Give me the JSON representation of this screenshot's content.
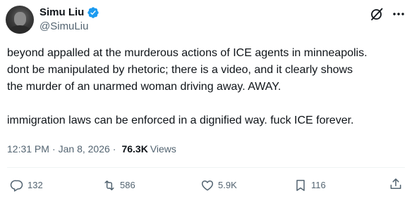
{
  "author": {
    "display_name": "Simu Liu",
    "handle": "@SimuLiu",
    "verified": true
  },
  "tweet": {
    "lines": [
      "beyond appalled at the murderous actions of ICE agents in minneapolis.",
      "dont be manipulated by rhetoric; there is a video, and it clearly shows",
      "the murder of an unarmed woman driving away. AWAY."
    ],
    "lines_after_break": [
      "immigration laws can be enforced in a dignified way. fuck ICE forever."
    ]
  },
  "meta": {
    "time": "12:31 PM",
    "separator": "·",
    "date": "Jan 8, 2026",
    "views_count": "76.3K",
    "views_label": "Views"
  },
  "actions": {
    "replies": "132",
    "reposts": "586",
    "likes": "5.9K",
    "bookmarks": "116"
  },
  "icons": {
    "verified": "verified-badge-icon",
    "grok": "grok-icon",
    "more": "more-icon",
    "reply": "reply-icon",
    "repost": "repost-icon",
    "like": "heart-icon",
    "bookmark": "bookmark-icon",
    "share": "share-icon"
  },
  "colors": {
    "verified_blue": "#1d9bf0",
    "text_primary": "#0f1419",
    "text_secondary": "#536471",
    "divider": "#eff3f4"
  }
}
